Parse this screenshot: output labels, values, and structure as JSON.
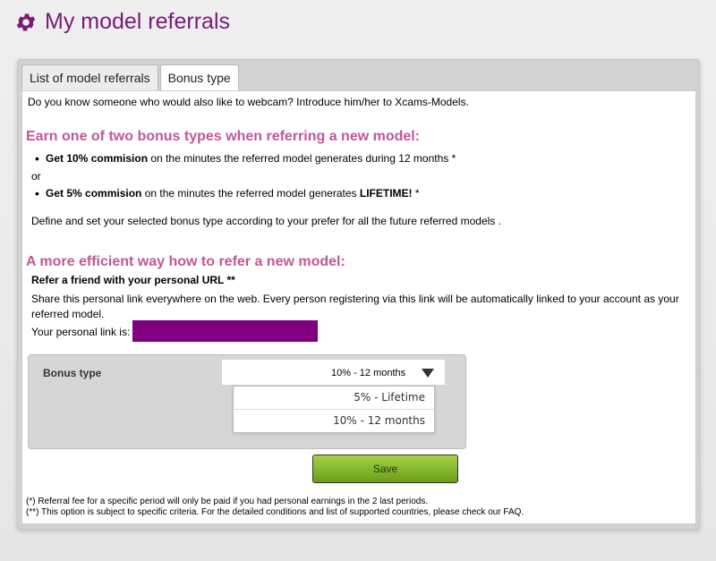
{
  "header": {
    "icon": "gear-icon",
    "title": "My model referrals",
    "accent": "#7a1a7a"
  },
  "tabs": [
    {
      "label": "List of model referrals",
      "active": false
    },
    {
      "label": "Bonus type",
      "active": true
    }
  ],
  "intro": "Do you know someone who would also like to webcam? Introduce him/her to Xcams-Models.",
  "bonus_section": {
    "heading": "Earn one of two bonus types when referring a new model:",
    "bullet1": {
      "bold": "Get 10% commision",
      "rest": " on the minutes the referred model generates during 12 months *"
    },
    "or": "or",
    "bullet2": {
      "bold": "Get 5% commision",
      "rest": " on the minutes the referred model generates ",
      "bold_end": "LIFETIME!",
      "suffix": " *"
    },
    "define": "Define and set your selected bonus type according to your prefer for all the future referred models ."
  },
  "refer_section": {
    "heading": "A more efficient way how to refer a new model:",
    "subheading": "Refer a friend with your personal URL **",
    "share": "Share this personal link everywhere on the web. Every person registering via this link will be automatically linked to your account as your referred model.",
    "link_label": "Your personal link is:",
    "link_color": "#800080"
  },
  "form": {
    "bonus_label": "Bonus type",
    "selected": "10% - 12 months",
    "options": [
      "5% - Lifetime",
      "10% - 12 months"
    ],
    "save_label": "Save"
  },
  "footnotes": [
    "(*) Referral fee for a specific period will only be paid if you had personal earnings in the 2 last periods.",
    "(**) This option is subject to specific criteria. For the detailed conditions and list of supported countries, please check our FAQ."
  ]
}
